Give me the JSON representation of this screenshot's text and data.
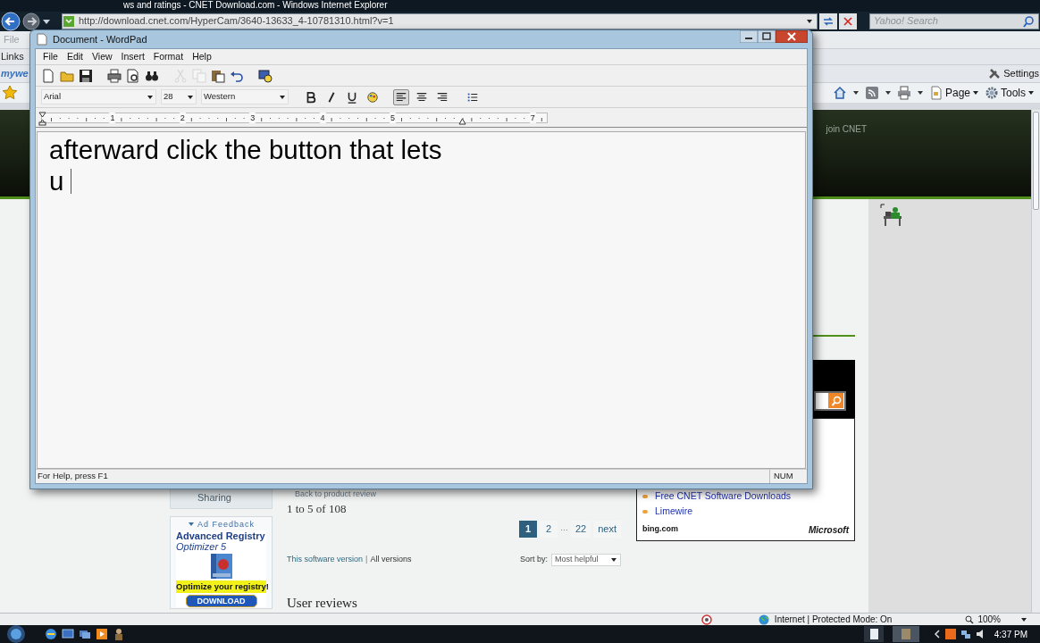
{
  "ie": {
    "title": "ws and ratings - CNET Download.com - Windows Internet Explorer",
    "address": "http://download.cnet.com/HyperCam/3640-13633_4-10781310.html?v=1",
    "search_placeholder": "Yahoo! Search",
    "menu": [
      "File"
    ],
    "links_label": "Links",
    "toolbar_text": "mywe",
    "settings": "Settings",
    "commands": [
      {
        "kind": "home"
      },
      {
        "kind": "feeds"
      },
      {
        "kind": "print"
      },
      {
        "kind": "page",
        "label": "Page"
      },
      {
        "kind": "tools",
        "label": "Tools"
      }
    ]
  },
  "page": {
    "header_link": "join CNET",
    "sidebar_item": "Sharing",
    "ad": {
      "feedback": "Ad Feedback",
      "title": "Advanced Registry",
      "subtitle": "Optimizer 5",
      "tagline": "Optimize your registry!",
      "button": "DOWNLOAD"
    },
    "reviews": {
      "back_link": "Back to product review",
      "count": "1 to 5 of 108",
      "pages": [
        {
          "kind": "page",
          "label": "1",
          "selected": true
        },
        {
          "kind": "page",
          "label": "2",
          "selected": false
        },
        {
          "kind": "gap",
          "label": "…"
        },
        {
          "kind": "page",
          "label": "22",
          "selected": false
        },
        {
          "kind": "page",
          "label": "next",
          "selected": false
        }
      ],
      "version_link": "This software version",
      "separator": "|",
      "all_versions": "All versions",
      "sort_label": "Sort by:",
      "sort_value": "Most helpful",
      "heading": "User reviews"
    },
    "bing": {
      "links": [
        "Free CNET Software Downloads",
        "Limewire"
      ],
      "footer": "bing.com",
      "brand": "Microsoft"
    }
  },
  "status_bar": {
    "zone": "Internet | Protected Mode: On",
    "zoom": "100%"
  },
  "taskbar": {
    "clock": "4:37 PM"
  },
  "wordpad": {
    "title": "Document - WordPad",
    "menu": [
      "File",
      "Edit",
      "View",
      "Insert",
      "Format",
      "Help"
    ],
    "toolbar": [
      {
        "kind": "new",
        "disabled": false
      },
      {
        "kind": "open",
        "disabled": false
      },
      {
        "kind": "save",
        "disabled": false
      },
      {
        "kind": "sep"
      },
      {
        "kind": "print",
        "disabled": false
      },
      {
        "kind": "preview",
        "disabled": false
      },
      {
        "kind": "find",
        "disabled": false
      },
      {
        "kind": "sep"
      },
      {
        "kind": "cut",
        "disabled": true
      },
      {
        "kind": "copy",
        "disabled": true
      },
      {
        "kind": "paste",
        "disabled": false
      },
      {
        "kind": "undo",
        "disabled": false
      },
      {
        "kind": "sep"
      },
      {
        "kind": "datetime",
        "disabled": false
      }
    ],
    "font": "Arial",
    "size": "28",
    "script": "Western",
    "format_buttons": [
      {
        "kind": "bold",
        "selected": false
      },
      {
        "kind": "italic",
        "selected": false
      },
      {
        "kind": "underline",
        "selected": false
      },
      {
        "kind": "color",
        "selected": false
      },
      {
        "kind": "align-left",
        "selected": true
      },
      {
        "kind": "align-center",
        "selected": false
      },
      {
        "kind": "align-right",
        "selected": false
      },
      {
        "kind": "bullets",
        "selected": false
      }
    ],
    "ruler": [
      "1",
      "2",
      "3",
      "4",
      "5",
      "7"
    ],
    "lines": [
      "afterward click the button that lets",
      "u"
    ],
    "status": "For Help, press F1",
    "indicator": "NUM"
  }
}
